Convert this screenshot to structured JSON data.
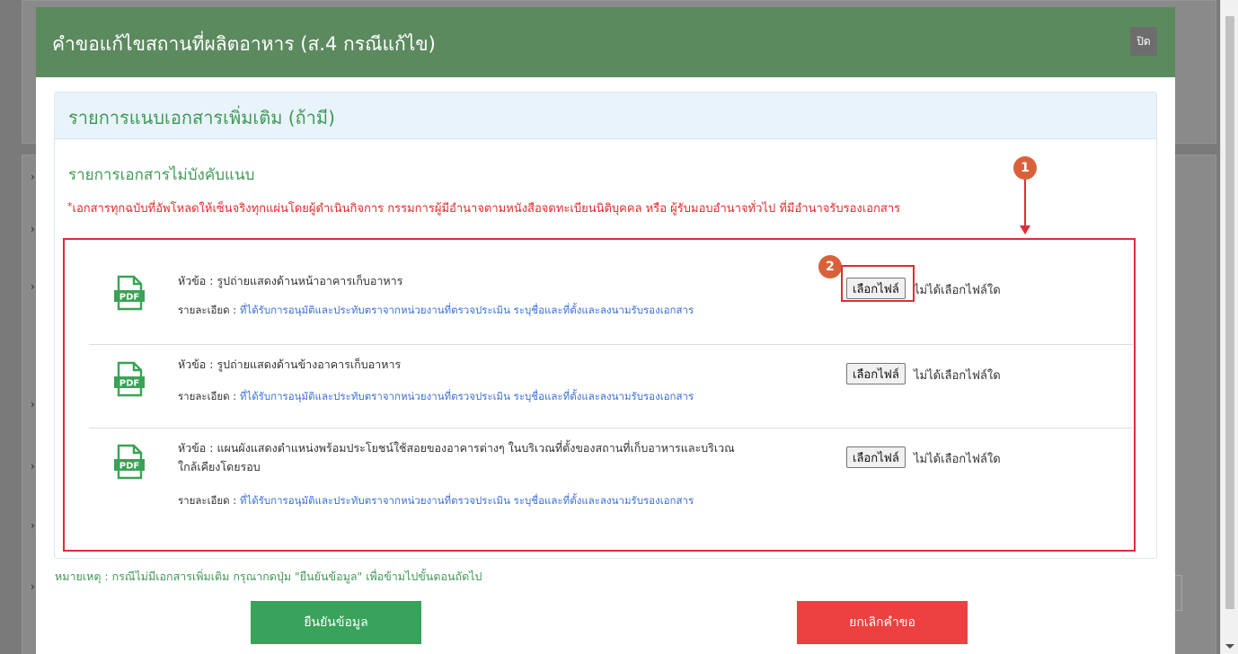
{
  "modal": {
    "title": "คำขอแก้ไขสถานที่ผลิตอาหาร (ส.4 กรณีแก้ไข)",
    "close_label": "ปิด"
  },
  "panel": {
    "title": "รายการแนบเอกสารเพิ่มเติม (ถ้ามี)",
    "section_title": "รายการเอกสารไม่บังคับแนบ",
    "warning_star": "*",
    "warning_text": "เอกสารทุกฉบับที่อัพโหลดให้เซ็นจริงทุกแผ่นโดยผู้ดำเนินกิจการ กรรมการผู้มีอำนาจตามหนังสือจดทะเบียนนิติบุคคล หรือ ผู้รับมอบอำนาจทั่วไป ที่มีอำนาจรับรองเอกสาร"
  },
  "documents": [
    {
      "icon": "pdf-icon",
      "icon_label": "PDF",
      "topic": "หัวข้อ : รูปถ่ายแสดงด้านหน้าอาคารเก็บอาหาร",
      "topic_line2": "",
      "detail_label": "รายละเอียด : ",
      "detail_value": "ที่ได้รับการอนุมัติและประทับตราจากหน่วยงานที่ตรวจประเมิน ระบุชื่อและที่ตั้งและลงนามรับรองเอกสาร",
      "choose_label": "เลือกไฟล์",
      "status": "ไม่ได้เลือกไฟล์ใด"
    },
    {
      "icon": "pdf-icon",
      "icon_label": "PDF",
      "topic": "หัวข้อ : รูปถ่ายแสดงด้านข้างอาคารเก็บอาหาร",
      "topic_line2": "",
      "detail_label": "รายละเอียด : ",
      "detail_value": "ที่ได้รับการอนุมัติและประทับตราจากหน่วยงานที่ตรวจประเมิน ระบุชื่อและที่ตั้งและลงนามรับรองเอกสาร",
      "choose_label": "เลือกไฟล์",
      "status": "ไม่ได้เลือกไฟล์ใด"
    },
    {
      "icon": "pdf-icon",
      "icon_label": "PDF",
      "topic": "หัวข้อ : แผนผังแสดงตำแหน่งพร้อมประโยชน์ใช้สอยของอาคารต่างๆ ในบริเวณที่ตั้งของสถานที่เก็บอาหารและบริเวณ",
      "topic_line2": "ใกล้เคียงโดยรอบ",
      "detail_label": "รายละเอียด : ",
      "detail_value": "ที่ได้รับการอนุมัติและประทับตราจากหน่วยงานที่ตรวจประเมิน ระบุชื่อและที่ตั้งและลงนามรับรองเอกสาร",
      "choose_label": "เลือกไฟล์",
      "status": "ไม่ได้เลือกไฟล์ใด"
    }
  ],
  "annotations": {
    "marker_1": "1",
    "marker_2": "2",
    "color": "#e02c37",
    "marker_color": "#d9613a"
  },
  "note": "หมายเหตุ : กรณีไม่มีเอกสารเพิ่มเติม กรุณากดปุ่ม \"ยืนยันข้อมูล\" เพื่อข้ามไปขั้นตอนถัดไป",
  "actions": {
    "confirm_label": "ยืนยันข้อมูล",
    "cancel_label": "ยกเลิกคำขอ"
  },
  "colors": {
    "header_green": "#5b8a5e",
    "title_green": "#3f9a55",
    "confirm_green": "#38a35a",
    "cancel_red": "#ec4140",
    "link_blue": "#3a6fd8"
  }
}
